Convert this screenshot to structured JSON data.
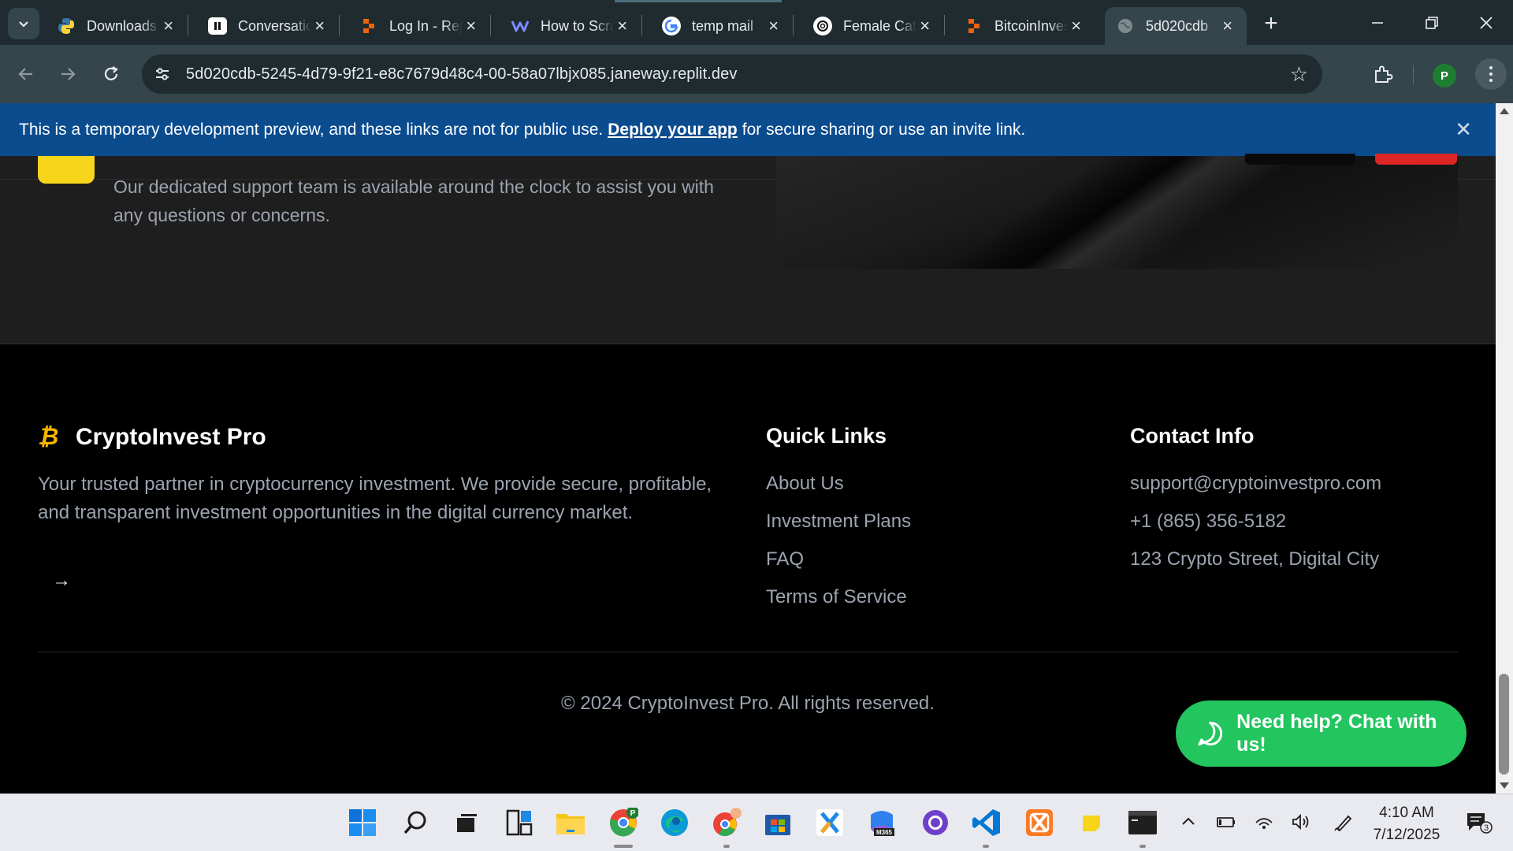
{
  "browser": {
    "tabs": [
      {
        "title": "Downloads",
        "favicon": "python-icon",
        "fav_color": "#3776ab"
      },
      {
        "title": "Conversation",
        "favicon": "pause-app-icon",
        "fav_color": "#ffffff"
      },
      {
        "title": "Log In - Replit",
        "favicon": "replit-icon",
        "fav_color": "#f26207"
      },
      {
        "title": "How to Scrape",
        "favicon": "wave-icon",
        "fav_color": "#7b61ff"
      },
      {
        "title": "temp mail",
        "favicon": "google-icon",
        "fav_color": "#ffffff"
      },
      {
        "title": "Female Cats",
        "favicon": "openai-icon",
        "fav_color": "#ffffff"
      },
      {
        "title": "BitcoinInvest",
        "favicon": "replit-icon",
        "fav_color": "#f26207"
      },
      {
        "title": "5d020cdb",
        "favicon": "globe-icon",
        "fav_color": "#9aa0a6",
        "active": true
      }
    ],
    "address": "5d020cdb-5245-4d79-9f21-e8c7679d48c4-00-58a07lbjx085.janeway.replit.dev",
    "profile_initial": "P"
  },
  "dev_banner": {
    "text_before": "This is a temporary development preview, and these links are not for public use.",
    "link": "Deploy your app",
    "text_after": "for secure sharing or use an invite link."
  },
  "feature": {
    "description": "Our dedicated support team is available around the clock to assist you with any questions or concerns."
  },
  "footer": {
    "brand_symbol": "₿",
    "brand_name": "CryptoInvest Pro",
    "about": "Your trusted partner in cryptocurrency investment. We provide secure, profitable, and transparent investment opportunities in the digital currency market.",
    "arrow": "→",
    "quick_links_title": "Quick Links",
    "quick_links": [
      "About Us",
      "Investment Plans",
      "FAQ",
      "Terms of Service"
    ],
    "contact_title": "Contact Info",
    "contact": [
      "support@cryptoinvestpro.com",
      "+1 (865) 356-5182",
      "123 Crypto Street, Digital City"
    ],
    "copyright": "© 2024 CryptoInvest Pro. All rights reserved."
  },
  "chat_button": {
    "label": "Need help? Chat with us!",
    "color": "#22c55e"
  },
  "taskbar": {
    "time": "4:10 AM",
    "date": "7/12/2025",
    "notification_count": "3",
    "chrome_badge": "P",
    "m365_label": "M365"
  },
  "colors": {
    "accent_yellow": "#f7b500",
    "banner_blue": "#0b4c8f",
    "tab_bg": "#1f2b2f"
  }
}
